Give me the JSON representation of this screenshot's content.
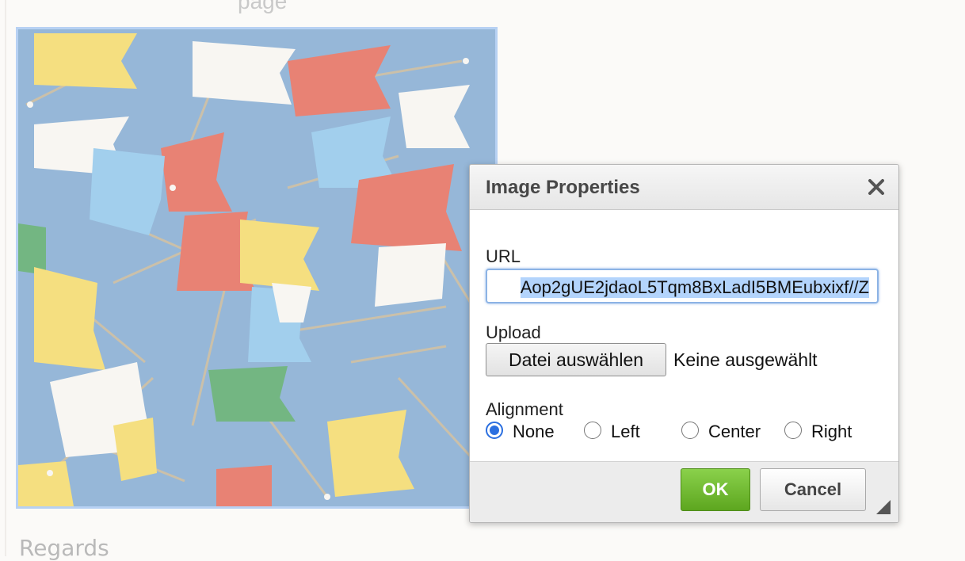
{
  "page": {
    "top_text": "page",
    "regards": "Regards"
  },
  "image": {
    "alt": "Colored push-pin flags"
  },
  "dialog": {
    "title": "Image Properties",
    "close_icon": "close-icon",
    "url_label": "URL",
    "url_value": "Aop2gUE2jdaoL5Tqm8BxLadI5BMEubxixf//Z",
    "upload_label": "Upload",
    "file_button_label": "Datei auswählen",
    "file_status": "Keine ausgewählt",
    "alignment_label": "Alignment",
    "alignment_options": [
      {
        "label": "None",
        "checked": true
      },
      {
        "label": "Left",
        "checked": false
      },
      {
        "label": "Center",
        "checked": false
      },
      {
        "label": "Right",
        "checked": false
      }
    ],
    "ok_label": "OK",
    "cancel_label": "Cancel"
  },
  "colors": {
    "accent": "#2b6fe0",
    "ok_green": "#6cb52a",
    "image_bg": "#6e9cc9"
  }
}
